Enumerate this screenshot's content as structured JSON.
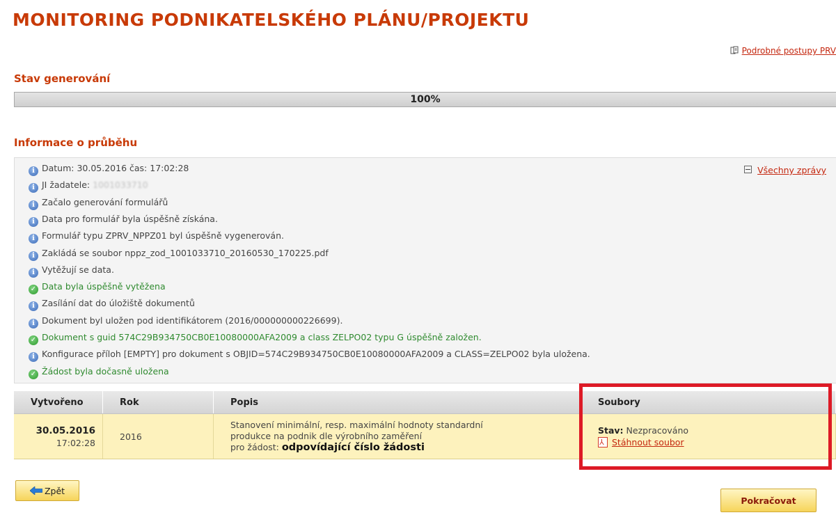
{
  "header": {
    "title": "MONITORING PODNIKATELSKÉHO PLÁNU/PROJEKTU",
    "procedures_link": "Podrobné postupy PRV"
  },
  "generation": {
    "heading": "Stav generování",
    "progress_text": "100%",
    "progress_fraction": 1.0
  },
  "log": {
    "heading": "Informace o průběhu",
    "all_messages_link": "Všechny zprávy",
    "messages": [
      {
        "type": "info",
        "prefix": "",
        "text": "Datum: 30.05.2016 čas: 17:02:28"
      },
      {
        "type": "info",
        "prefix": "JI žadatele: ",
        "text": "1001033710"
      },
      {
        "type": "info",
        "prefix": "",
        "text": "Začalo generování formulářů"
      },
      {
        "type": "info",
        "prefix": "",
        "text": "Data pro formulář byla úspěšně získána."
      },
      {
        "type": "info",
        "prefix": "",
        "text": "Formulář typu ZPRV_NPPZ01 byl úspěšně vygenerován."
      },
      {
        "type": "info",
        "prefix": "",
        "text": "Zakládá se soubor nppz_zod_1001033710_20160530_170225.pdf"
      },
      {
        "type": "info",
        "prefix": "",
        "text": "Vytěžují se data."
      },
      {
        "type": "success",
        "prefix": "",
        "text": "Data byla úspěšně vytěžena"
      },
      {
        "type": "info",
        "prefix": "",
        "text": "Zasílání dat do úložiště dokumentů"
      },
      {
        "type": "info",
        "prefix": "",
        "text": "Dokument byl uložen pod identifikátorem (2016/000000000226699)."
      },
      {
        "type": "success",
        "prefix": "",
        "text": "Dokument s guid 574C29B934750CB0E10080000AFA2009 a class ZELPO02 typu G úspěšně založen."
      },
      {
        "type": "info",
        "prefix": "",
        "text": "Konfigurace příloh [EMPTY] pro dokument s OBJID=574C29B934750CB0E10080000AFA2009 a CLASS=ZELPO02 byla uložena."
      },
      {
        "type": "success",
        "prefix": "",
        "text": "Žádost byla dočasně uložena"
      }
    ]
  },
  "table": {
    "columns": [
      "Vytvořeno",
      "Rok",
      "Popis",
      "Soubory"
    ],
    "row": {
      "date": "30.05.2016",
      "time": "17:02:28",
      "year": "2016",
      "description_line1": "Stanovení minimální, resp. maximální hodnoty standardní",
      "description_line2": "produkce na podnik dle výrobního zaměření",
      "description_prefix": "pro žádost: ",
      "description_emphasis": "odpovídající číslo žádosti",
      "status_label": "Stav:",
      "status_value": "Nezpracováno",
      "download_link": "Stáhnout soubor"
    }
  },
  "buttons": {
    "back": "Zpět",
    "continue": "Pokračovat"
  },
  "colors": {
    "heading": "#c83a07",
    "link": "#c4260e",
    "highlight": "#dd1a26",
    "row_bg": "#fdf2bd",
    "success_text": "#2f8a2f"
  }
}
